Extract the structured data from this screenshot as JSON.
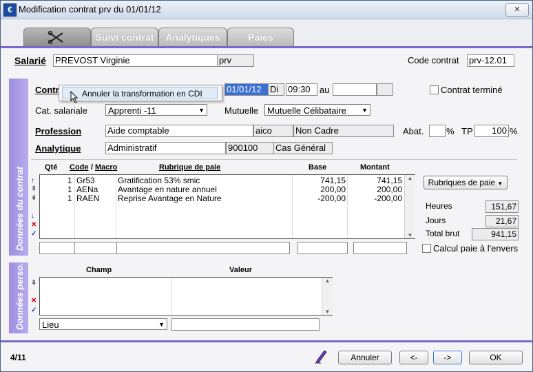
{
  "window": {
    "title": "Modification contrat prv du 01/01/12",
    "close_label": "✕"
  },
  "tabs": [
    {
      "label": "",
      "icon": "scissors-icon",
      "active": true
    },
    {
      "label": "Suivi contrat"
    },
    {
      "label": "Analytiques"
    },
    {
      "label": "Paies"
    }
  ],
  "header": {
    "salarie_label": "Salarié",
    "salarie_name": "PREVOST Virginie",
    "salarie_code": "prv",
    "code_contrat_label": "Code contrat",
    "code_contrat_value": "prv-12.01"
  },
  "section_contrat": {
    "side_label": "Données du contrat",
    "contrat_label": "Contrat",
    "date_value": "01/01/12",
    "day_value": "Di",
    "time_value": "09:30",
    "au_label": "au",
    "au_date": "",
    "au_day": "",
    "contrat_termine_label": "Contrat terminé",
    "cat_salariale_label": "Cat. salariale",
    "cat_salariale_value": "Apprenti -11",
    "mutuelle_label": "Mutuelle",
    "mutuelle_value": "Mutuelle Célibataire",
    "profession_label": "Profession",
    "profession_value": "Aide comptable",
    "profession_code": "aico",
    "cadre_value": "Non Cadre",
    "abat_label": "Abat.",
    "abat_value": "",
    "percent1": "%",
    "tp_label": "TP",
    "tp_value": "100",
    "percent2": "%",
    "analytique_label": "Analytique",
    "analytique_value": "Administratif",
    "analytique_code": "900100",
    "analytique_cas": "Cas Général"
  },
  "grid": {
    "headers": {
      "qte": "Qté",
      "code": "Code",
      "slash": "/",
      "macro": "Macro",
      "rubrique": "Rubrique de paie",
      "base": "Base",
      "montant": "Montant"
    },
    "rows": [
      {
        "qte": "1",
        "code": "Gr53",
        "rubrique": "Gratification 53% smic",
        "base": "741,15",
        "montant": "741,15"
      },
      {
        "qte": "1",
        "code": "AENa",
        "rubrique": "Avantage en nature annuel",
        "base": "200,00",
        "montant": "200,00"
      },
      {
        "qte": "1",
        "code": "RAEN",
        "rubrique": "Reprise Avantage en Nature",
        "base": "-200,00",
        "montant": "-200,00"
      }
    ]
  },
  "totals": {
    "rubriques_button": "Rubriques de paie",
    "heures_label": "Heures",
    "heures_value": "151,67",
    "jours_label": "Jours",
    "jours_value": "21,67",
    "total_brut_label": "Total brut",
    "total_brut_value": "941,15",
    "calcul_label": "Calcul paie à l'envers"
  },
  "context_menu": {
    "item": "Annuler la transformation en CDI"
  },
  "section_perso": {
    "side_label": "Données perso.",
    "champ_header": "Champ",
    "valeur_header": "Valeur",
    "lieu_value": "Lieu",
    "lieu_field": ""
  },
  "footer": {
    "page_counter": "4/11",
    "annuler_label": "Annuler",
    "prev_label": "<-",
    "next_label": "->",
    "ok_label": "OK"
  },
  "colors": {
    "accent": "#7a67c9",
    "side_panel": "#a999e8"
  }
}
